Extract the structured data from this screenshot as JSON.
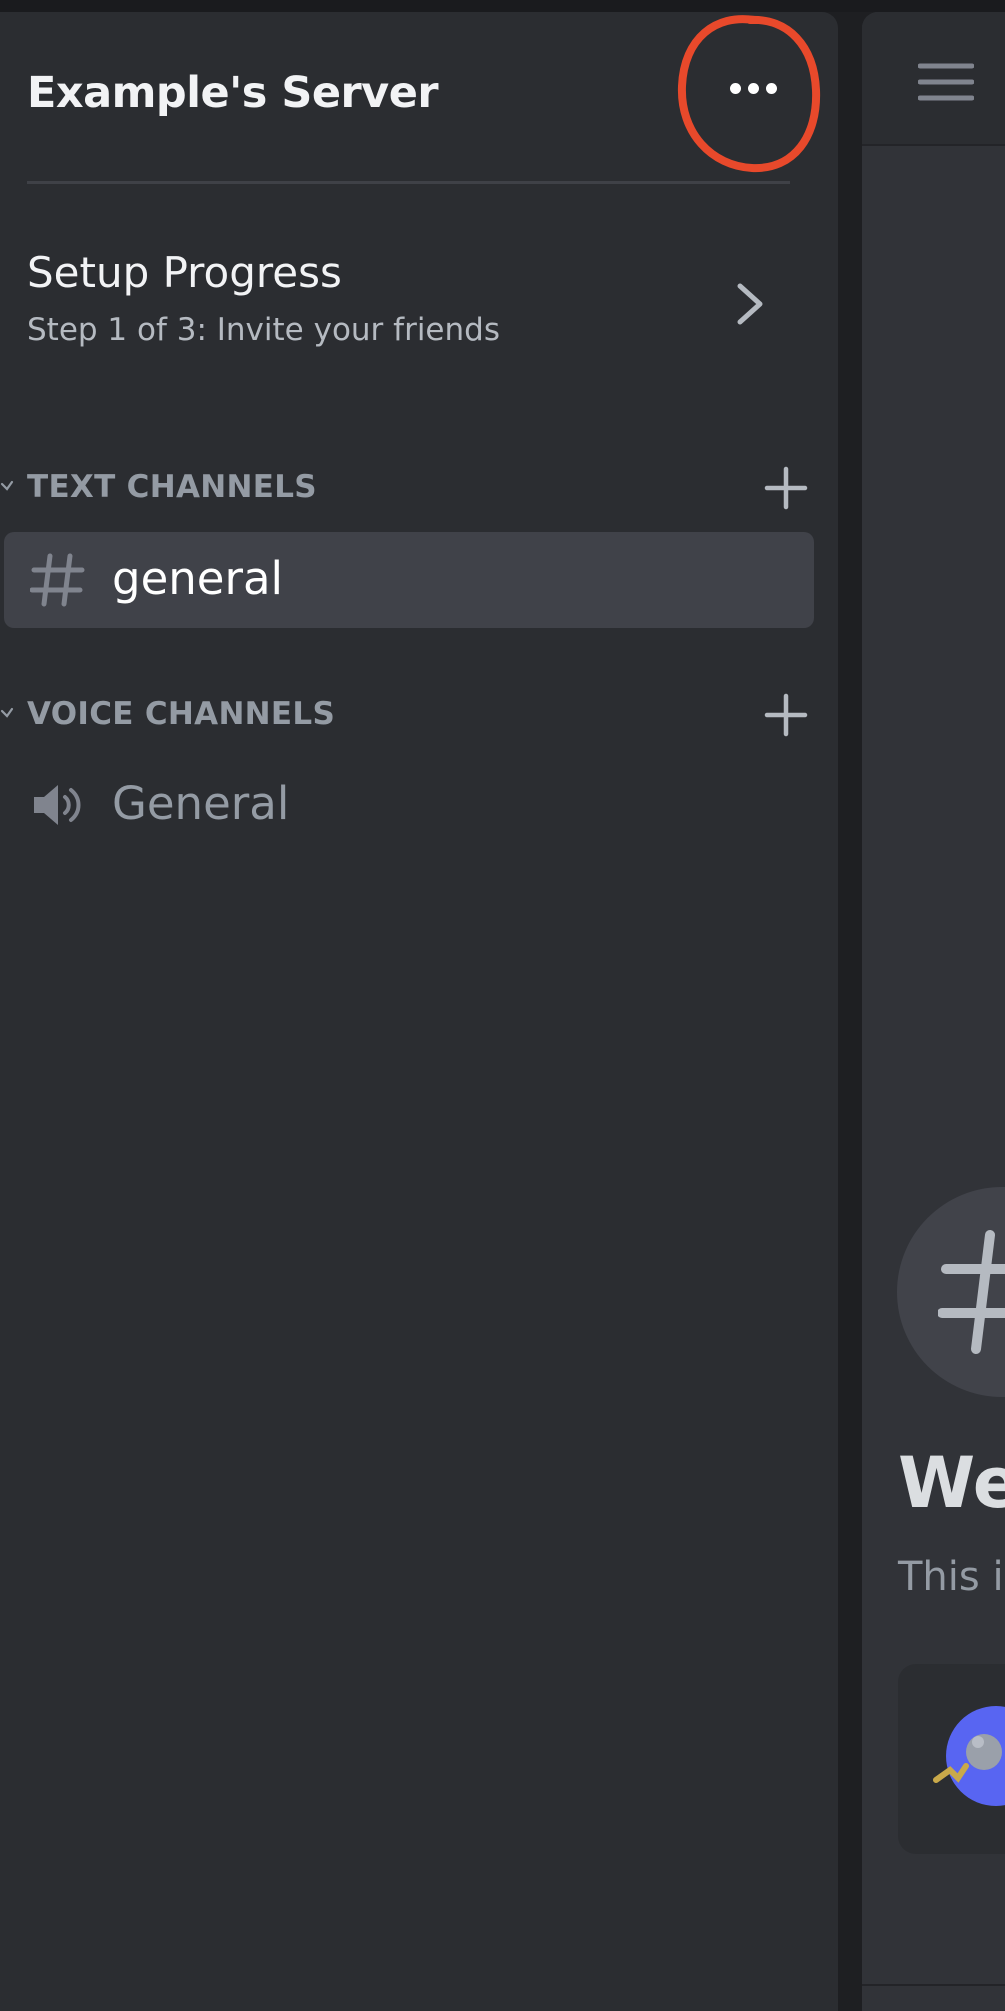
{
  "server": {
    "name": "Example's Server",
    "more_icon": "more-horizontal-icon"
  },
  "setup": {
    "title": "Setup Progress",
    "step_text": "Step 1 of 3: Invite your friends",
    "progress_fraction": 0.015
  },
  "categories": [
    {
      "label": "TEXT CHANNELS",
      "channels": [
        {
          "name": "general",
          "type": "text",
          "icon": "hash-icon",
          "selected": true
        }
      ]
    },
    {
      "label": "VOICE CHANNELS",
      "channels": [
        {
          "name": "General",
          "type": "voice",
          "icon": "speaker-icon",
          "selected": false
        }
      ]
    }
  ],
  "main": {
    "welcome_title_partial": "We",
    "welcome_subtitle_partial": "This i"
  },
  "colors": {
    "accent": "#5865f2",
    "sidebar_bg": "#2b2d31",
    "selected_bg": "#404249",
    "annotation": "#e8492b"
  }
}
